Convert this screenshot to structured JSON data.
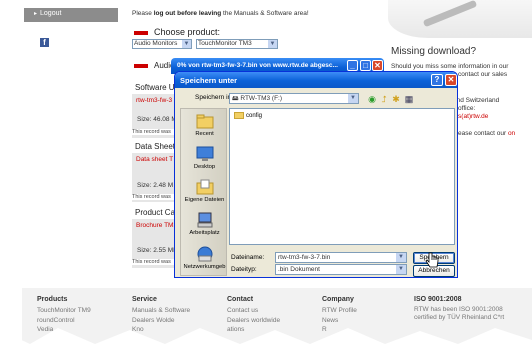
{
  "leftnav": {
    "logout_label": "Logout",
    "facebook_glyph": "f"
  },
  "main": {
    "notice_bold": "log out before leaving",
    "notice_prefix": "Please ",
    "notice_suffix": " the Manuals & Software area!",
    "choose_label": "Choose product:",
    "select_category": "Audio Monitors",
    "select_product": "TouchMonitor TM3",
    "audio_header": "Audio M",
    "sections": [
      {
        "head": "Software Upd",
        "link": "rtw-tm3-fw-3",
        "size": "Size: 46.08 M",
        "note": "This record was"
      },
      {
        "head": "Data Sheets",
        "link": "Data sheet T",
        "size": "Size: 2.48 M",
        "note": "This record was"
      },
      {
        "head": "Product Catal",
        "link": "Brochure TM3",
        "size": "Size: 2.55 ME",
        "note": "This record was"
      }
    ]
  },
  "right": {
    "heading": "Missing download?",
    "line1": "Should you miss some information in our",
    "line2": "contact our sales",
    "line3": "and Switzerland",
    "line4": "s office:",
    "line5": "les(at)rtw.de",
    "line6": "please contact our",
    "line6_link": "on"
  },
  "download_window": {
    "title": "0% von rtw-tm3-fw-3-7.bin von www.rtw.de abgesc..."
  },
  "dialog": {
    "title": "Speichern unter",
    "save_in_label": "Speichern in:",
    "save_in_value": "RTW-TM3 (F:)",
    "places": [
      {
        "label": "Recent",
        "icon": "recent-folder-icon"
      },
      {
        "label": "Desktop",
        "icon": "desktop-icon"
      },
      {
        "label": "Eigene Dateien",
        "icon": "my-documents-icon"
      },
      {
        "label": "Arbeitsplatz",
        "icon": "my-computer-icon"
      },
      {
        "label": "Netzwerkumgeb",
        "icon": "network-places-icon"
      }
    ],
    "files": [
      "config"
    ],
    "filename_label": "Dateiname:",
    "filename_value": "rtw-tm3-fw-3-7.bin",
    "filetype_label": "Dateityp:",
    "filetype_value": ".bin Dokument",
    "save_button": "Speichern",
    "cancel_button": "Abbrechen"
  },
  "footer": {
    "columns": [
      {
        "head": "Products",
        "items": [
          "TouchMonitor TM9",
          "roundControl",
          "Vedia"
        ]
      },
      {
        "head": "Service",
        "items": [
          "Manuals & Software",
          "Dealers  Wolde",
          "Kno"
        ]
      },
      {
        "head": "Contact",
        "items": [
          "Contact us",
          "Dealers worldwide",
          "ations"
        ]
      },
      {
        "head": "Company",
        "items": [
          "RTW Profile",
          "News",
          "R"
        ]
      },
      {
        "head": "ISO 9001:2008",
        "items": [
          "RTW has been ISO 9001:2008",
          "certified by TÜV Rheinland C*rt"
        ]
      }
    ]
  },
  "colors": {
    "accent_red": "#cc0000",
    "xp_title_blue": "#0b61d8",
    "dialog_bg": "#ece9d8"
  }
}
